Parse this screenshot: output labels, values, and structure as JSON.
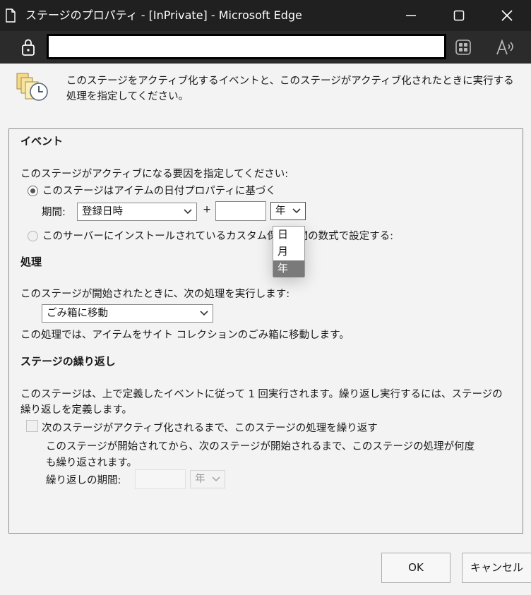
{
  "window": {
    "title": "ステージのプロパティ - [InPrivate] - Microsoft Edge",
    "url": ""
  },
  "intro": {
    "text": "このステージをアクティブ化するイベントと、このステージがアクティブ化されたときに実行する処理を指定してください。"
  },
  "event": {
    "heading": "イベント",
    "prompt": "このステージがアクティブになる要因を指定してください:",
    "option_date_label": "このステージはアイテムの日付プロパティに基づく",
    "period_label": "期間:",
    "date_property_value": "登録日時",
    "plus": "+",
    "offset_value": "",
    "unit_value": "年",
    "unit_options": [
      "日",
      "月",
      "年"
    ],
    "option_custom_label": "このサーバーにインストールされているカスタム保存期間の数式で設定する:"
  },
  "action": {
    "heading": "処理",
    "prompt": "このステージが開始されたときに、次の処理を実行します:",
    "selected_action": "ごみ箱に移動",
    "description": "この処理では、アイテムをサイト コレクションのごみ箱に移動します。"
  },
  "recurrence": {
    "heading": "ステージの繰り返し",
    "description_line1": "このステージは、上で定義したイベントに従って 1 回実行されます。繰り返し実行するには、ステージの",
    "description_line2": "繰り返しを定義します。",
    "checkbox_label": "次のステージがアクティブ化されるまで、このステージの処理を繰り返す",
    "sub_line1": "このステージが開始されてから、次のステージが開始されるまで、このステージの処理が何度",
    "sub_line2": "も繰り返されます。",
    "period_label": "繰り返しの期間:",
    "period_value": "",
    "unit_value": "年"
  },
  "buttons": {
    "ok": "OK",
    "cancel": "キャンセル"
  },
  "colors": {
    "titlebar": "#202020",
    "addressbar": "#2b2b2b",
    "dialog_bg": "#f3f3f3",
    "selected_option": "#7a7a7a"
  }
}
